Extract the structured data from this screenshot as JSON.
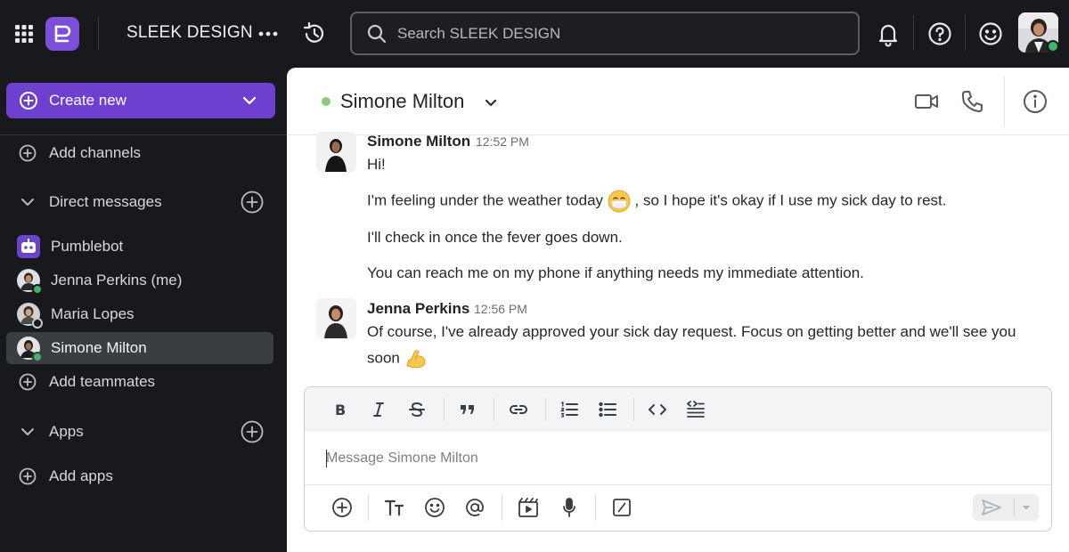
{
  "topbar": {
    "workspace_name": "SLEEK DESIGN",
    "search_placeholder": "Search SLEEK DESIGN",
    "icons": [
      "apps-grid-icon",
      "workspace-logo",
      "more-icon",
      "history-icon",
      "search-icon",
      "bell-icon",
      "help-icon",
      "emoji-status-icon",
      "user-avatar"
    ]
  },
  "sidebar": {
    "create_new_label": "Create new",
    "add_channels_label": "Add channels",
    "direct_messages_label": "Direct messages",
    "dms": [
      {
        "name": "Pumblebot",
        "status": "bot"
      },
      {
        "name": "Jenna Perkins (me)",
        "status": "online"
      },
      {
        "name": "Maria Lopes",
        "status": "away"
      },
      {
        "name": "Simone Milton",
        "status": "online",
        "active": true
      }
    ],
    "add_teammates_label": "Add teammates",
    "apps_label": "Apps",
    "add_apps_label": "Add apps"
  },
  "chat": {
    "header_name": "Simone Milton",
    "messages": [
      {
        "author": "Simone Milton",
        "time": "12:52 PM",
        "lines": [
          "Hi!",
          "I'm feeling under the weather today",
          ", so I hope it's okay if I use my sick day to rest.",
          "I'll check in once the fever goes down.",
          "You can reach me on my phone if anything needs my immediate attention."
        ]
      },
      {
        "author": "Jenna Perkins",
        "time": "12:56 PM",
        "lines": [
          "Of course, I've already approved your sick day request. Focus on getting better and we'll see you",
          "soon"
        ]
      }
    ]
  },
  "composer": {
    "placeholder": "Message Simone Milton",
    "format_tools": [
      "bold",
      "italic",
      "strikethrough",
      "quote",
      "link",
      "ordered-list",
      "bullet-list",
      "code",
      "code-block"
    ],
    "bottom_tools": [
      "attach",
      "text-format",
      "emoji",
      "mention",
      "gif-video",
      "microphone",
      "slash-command"
    ]
  },
  "colors": {
    "accent": "#6f3fd0",
    "online": "#43b26b",
    "sidebar_bg": "#17191c"
  }
}
